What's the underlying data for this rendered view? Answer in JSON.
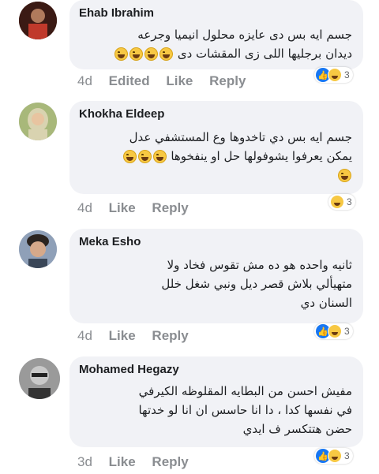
{
  "comments": [
    {
      "name": "Ehab Ibrahim",
      "text_line1": "جسم ايه بس دى عايزه محلول انيميا وجرعه",
      "text_line2": "ديدان برجليها اللى زى المقشات دى",
      "meta": {
        "time": "4d",
        "edited": "Edited",
        "like": "Like",
        "reply": "Reply"
      },
      "reactions": {
        "count": "3",
        "icons": [
          "like-icon",
          "haha-icon"
        ]
      }
    },
    {
      "name": "Khokha Eldeep",
      "text_line1": "جسم ايه بس دي تاخدوها وع المستشفي عدل",
      "text_line2": "يمكن يعرفوا يشوفولها حل او ينفخوها",
      "meta": {
        "time": "4d",
        "like": "Like",
        "reply": "Reply"
      },
      "reactions": {
        "count": "3",
        "icons": [
          "haha-icon"
        ]
      }
    },
    {
      "name": "Meka Esho",
      "text_line1": "ثانيه واحده هو ده مش تقوس فخاد ولا",
      "text_line2": "متهيألي بلاش قصر ديل ونبي شغل خلل",
      "text_line3": "السنان دي",
      "meta": {
        "time": "4d",
        "like": "Like",
        "reply": "Reply"
      },
      "reactions": {
        "count": "3",
        "icons": [
          "like-icon",
          "haha-icon"
        ]
      }
    },
    {
      "name": "Mohamed Hegazy",
      "text_line1": "مفيش احسن من البطايه المقلوظه الكيرفي",
      "text_line2": "في نفسها كدا ، دا انا حاسس ان انا لو خدتها",
      "text_line3": "حضن هتتكسر ف ايدي",
      "meta": {
        "time": "3d",
        "like": "Like",
        "reply": "Reply"
      },
      "reactions": {
        "count": "3",
        "icons": [
          "like-icon",
          "haha-icon"
        ]
      }
    }
  ]
}
